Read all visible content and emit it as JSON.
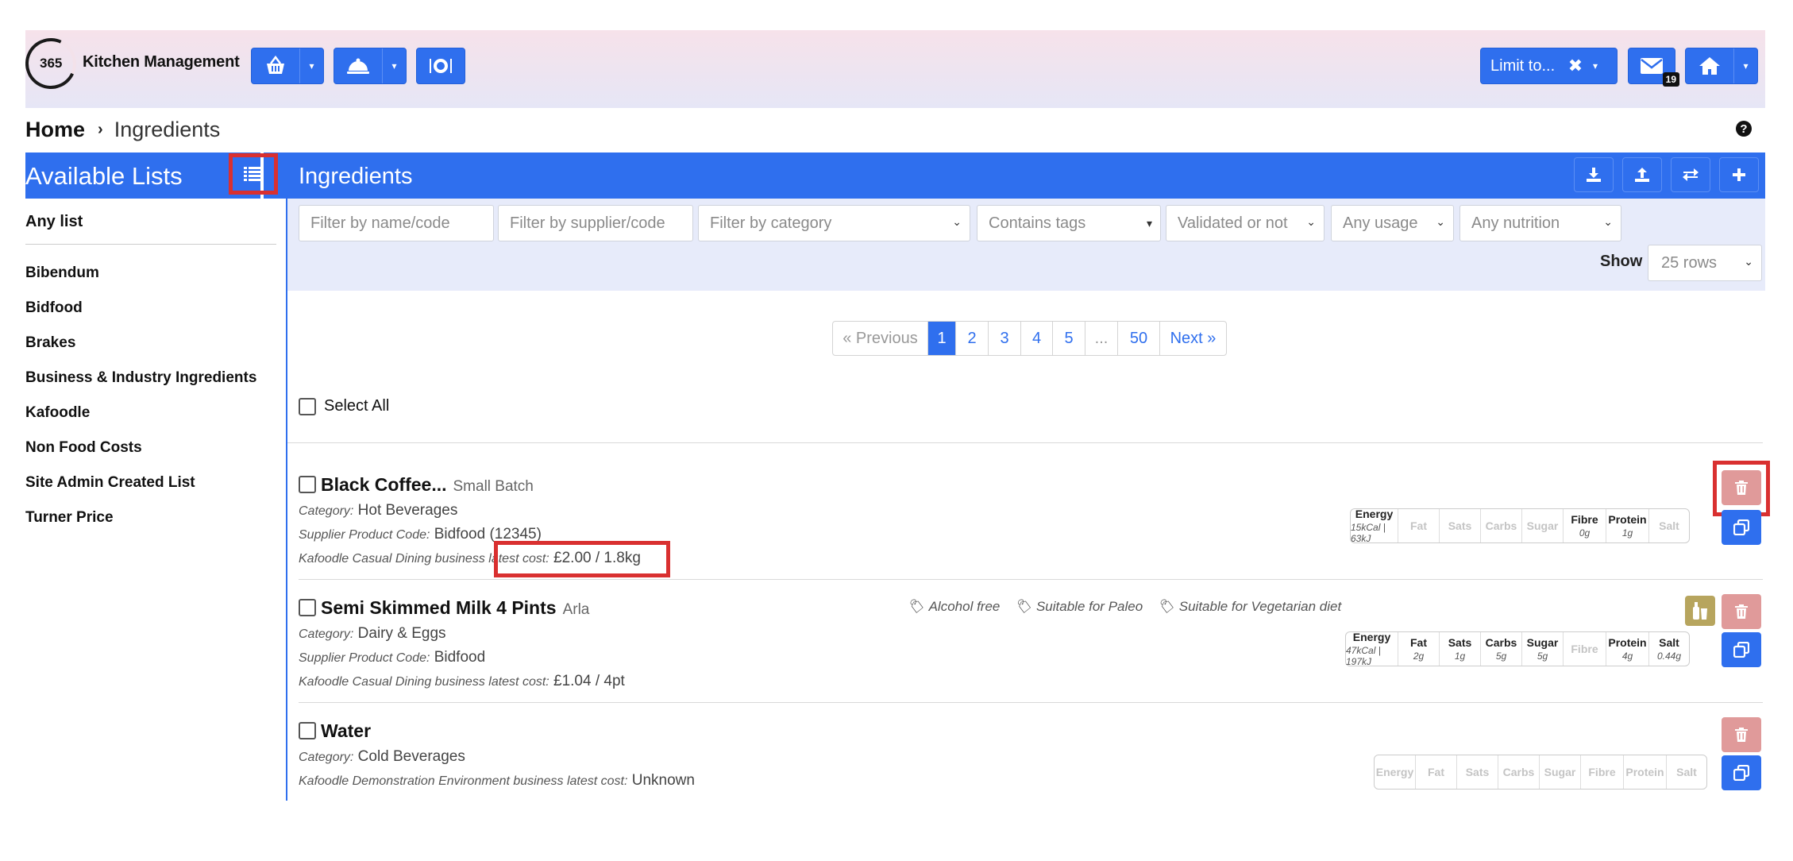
{
  "header": {
    "logo_text": "365",
    "brand": "Kitchen Management",
    "limit_label": "Limit to...",
    "limit_clear": "✖",
    "message_count": "19"
  },
  "breadcrumb": {
    "home": "Home",
    "separator": "›",
    "current": "Ingredients"
  },
  "help": "?",
  "sidebar": {
    "title": "Available Lists",
    "any_list": "Any list",
    "items": [
      {
        "label": "Bibendum"
      },
      {
        "label": "Bidfood"
      },
      {
        "label": "Brakes"
      },
      {
        "label": "Business & Industry Ingredients"
      },
      {
        "label": "Kafoodle"
      },
      {
        "label": "Non Food Costs"
      },
      {
        "label": "Site Admin Created List"
      },
      {
        "label": "Turner Price"
      }
    ]
  },
  "main": {
    "title": "Ingredients",
    "filters": {
      "name_placeholder": "Filter by name/code",
      "supplier_placeholder": "Filter by supplier/code",
      "category": "Filter by category",
      "tags": "Contains tags",
      "validated": "Validated or not",
      "usage": "Any usage",
      "nutrition": "Any nutrition"
    },
    "show_label": "Show",
    "show_value": "25 rows",
    "pagination": [
      "« Previous",
      "1",
      "2",
      "3",
      "4",
      "5",
      "...",
      "50",
      "Next »"
    ],
    "select_all": "Select All",
    "nutrition_labels": [
      "Energy",
      "Fat",
      "Sats",
      "Carbs",
      "Sugar",
      "Fibre",
      "Protein",
      "Salt"
    ],
    "rows": [
      {
        "name": "Black Coffee...",
        "brand": "Small Batch",
        "category_label": "Category:",
        "category": "Hot Beverages",
        "supplier_label": "Supplier Product Code:",
        "supplier": "Bidfood (12345)",
        "cost_label_a": "Kafoodle Casual Dining business ",
        "cost_label_b": "latest cost:",
        "cost": "£2.00 / 1.8kg",
        "energy": "15kCal | 63kJ",
        "fibre": "0g",
        "protein": "1g"
      },
      {
        "name": "Semi Skimmed Milk 4 Pints",
        "brand": "Arla",
        "category_label": "Category:",
        "category": "Dairy & Eggs",
        "supplier_label": "Supplier Product Code:",
        "supplier": "Bidfood",
        "cost_label": "Kafoodle Casual Dining business latest cost:",
        "cost": "£1.04 / 4pt",
        "tags": [
          "Alcohol free",
          "Suitable for Paleo",
          "Suitable for Vegetarian diet"
        ],
        "energy": "47kCal | 197kJ",
        "fat": "2g",
        "sats": "1g",
        "carbs": "5g",
        "sugar": "5g",
        "protein": "4g",
        "salt": "0.44g"
      },
      {
        "name": "Water",
        "category_label": "Category:",
        "category": "Cold Beverages",
        "cost_label": "Kafoodle Demonstration Environment business latest cost:",
        "cost": "Unknown"
      }
    ]
  },
  "colors": {
    "primary": "#2f6fee",
    "highlight": "#d93030",
    "delete": "#e09a9a",
    "drink": "#b7a55e"
  }
}
